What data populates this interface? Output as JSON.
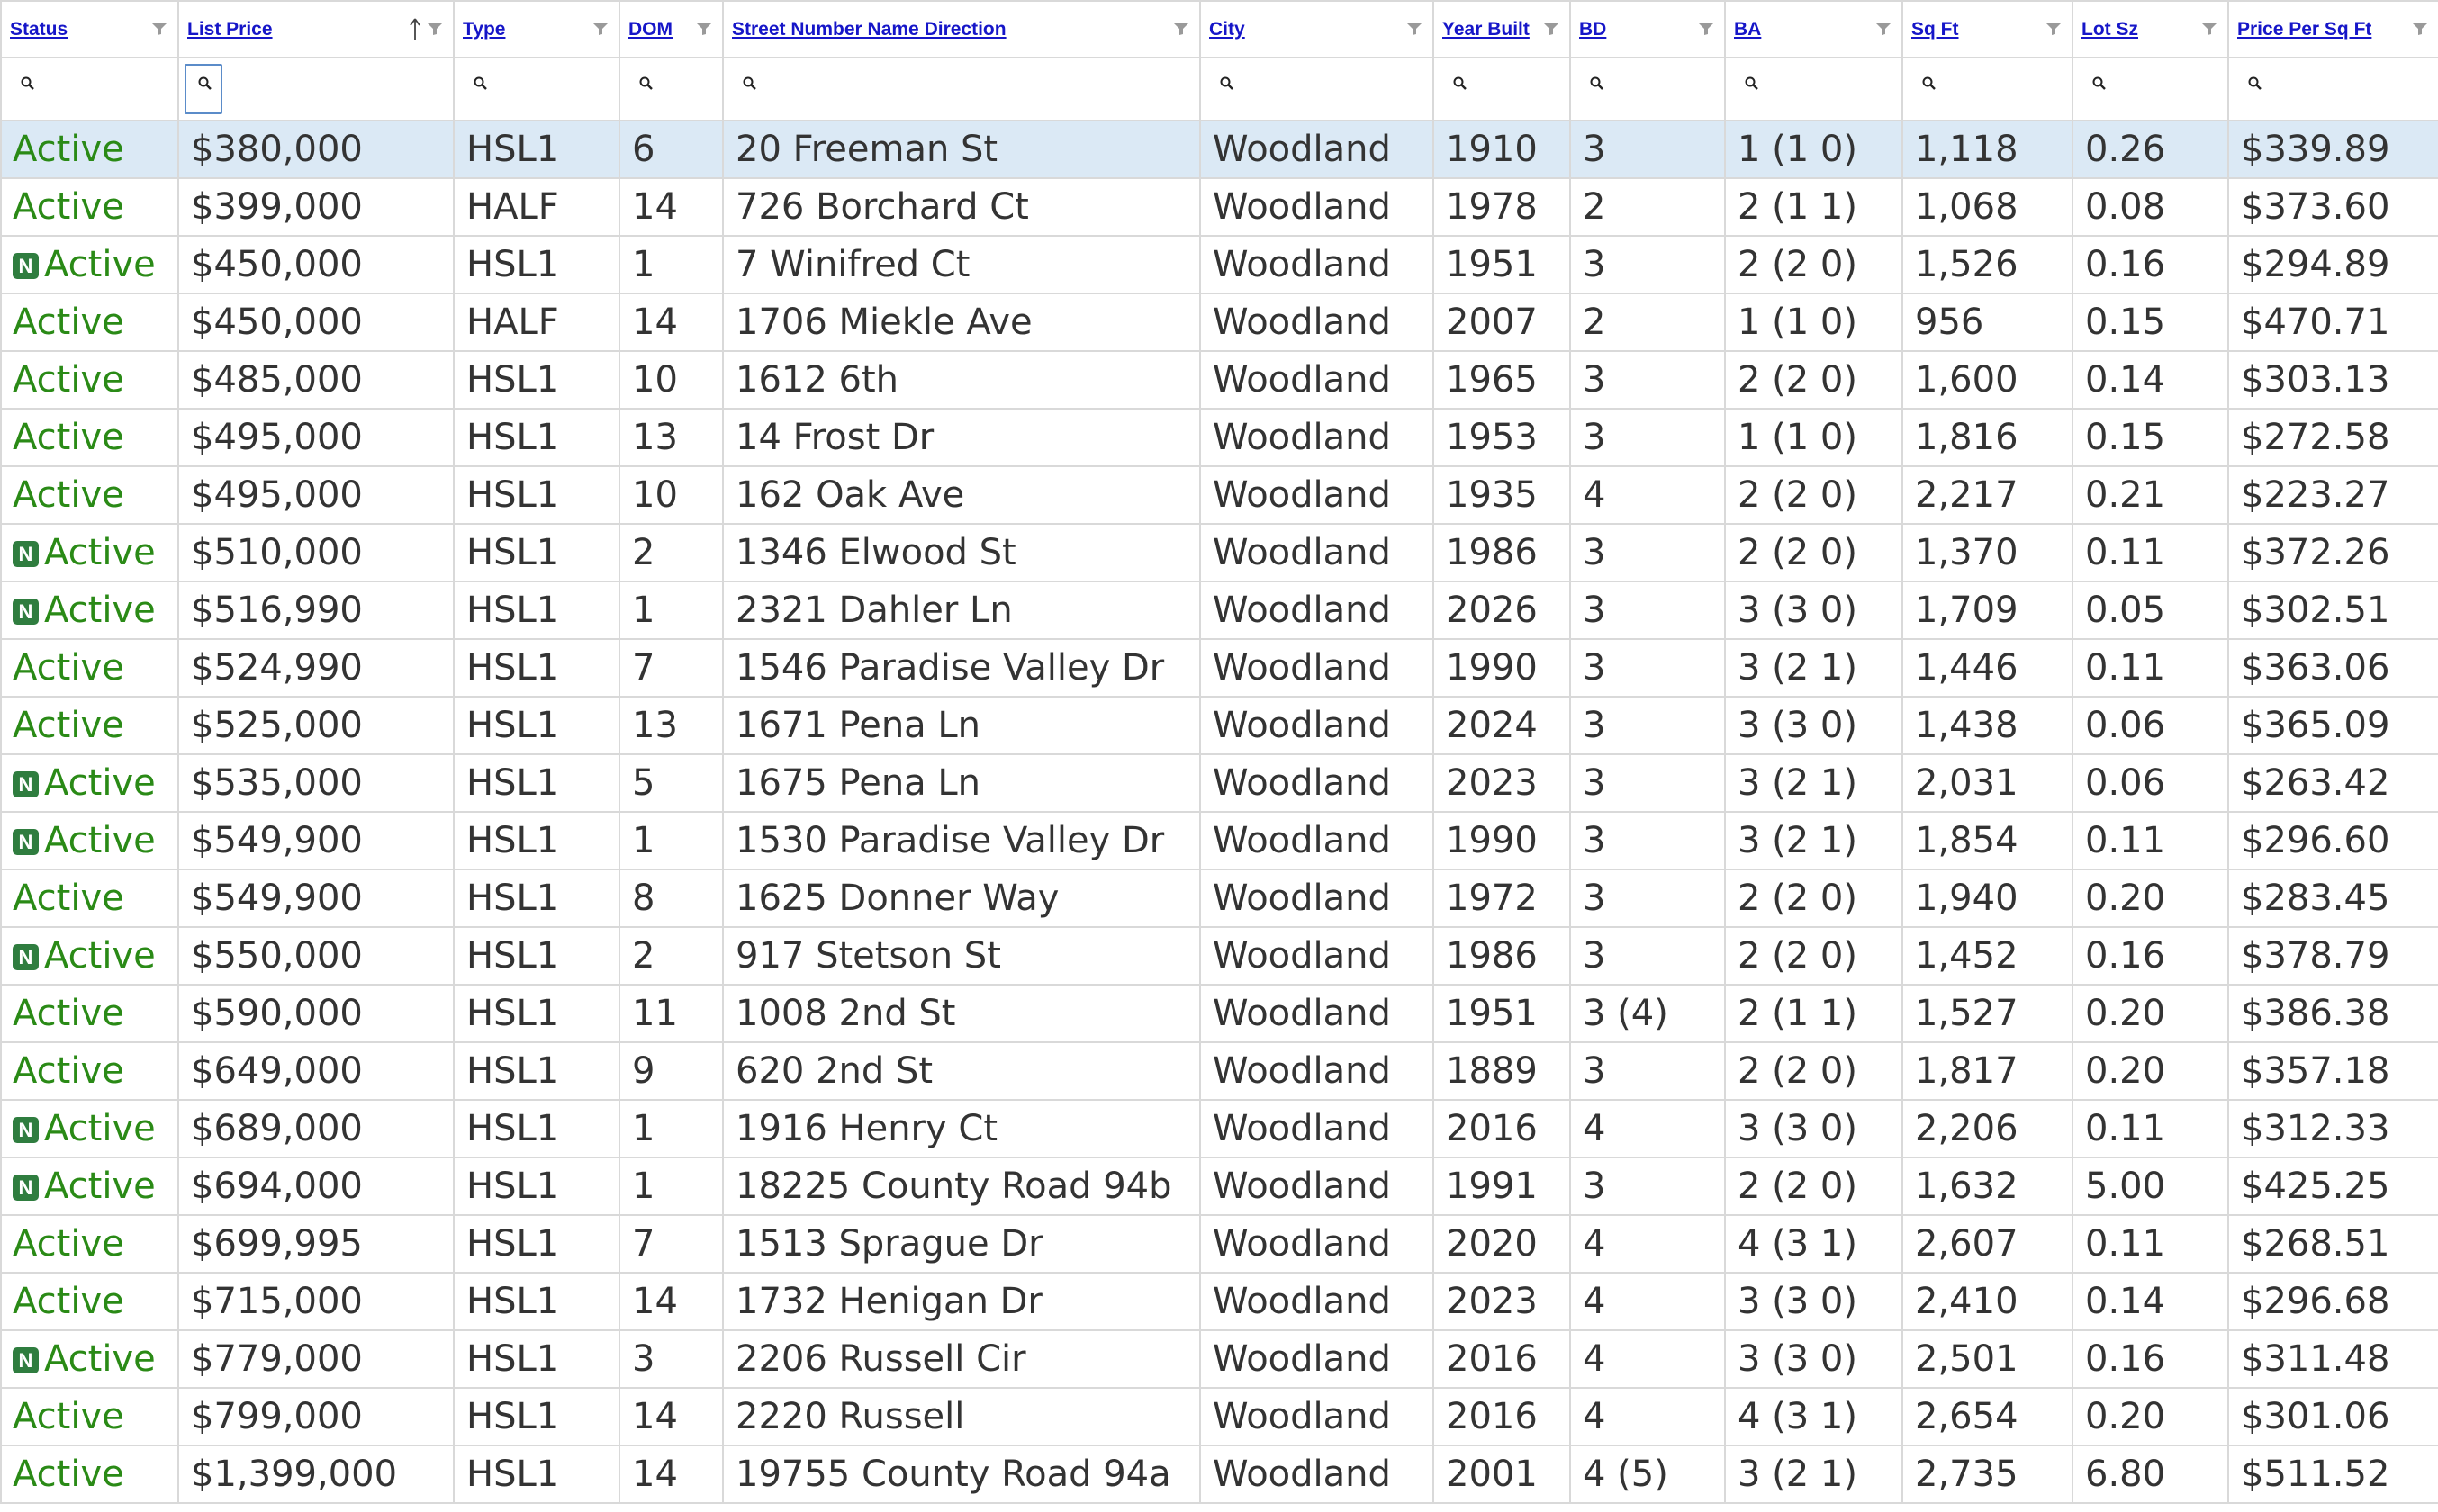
{
  "columns": [
    {
      "label": "Status"
    },
    {
      "label": "List Price"
    },
    {
      "label": "Type"
    },
    {
      "label": "DOM"
    },
    {
      "label": "Street Number Name Direction"
    },
    {
      "label": "City"
    },
    {
      "label": "Year Built"
    },
    {
      "label": "BD"
    },
    {
      "label": "BA"
    },
    {
      "label": "Sq Ft"
    },
    {
      "label": "Lot Sz"
    },
    {
      "label": "Price Per Sq Ft"
    }
  ],
  "sort": {
    "column": "List Price",
    "direction": "ascending"
  },
  "new_badge_label": "N",
  "colors": {
    "link": "#1616c8",
    "status_active": "#2a8a16",
    "badge": "#2f7d3f",
    "selected_row": "#dbe9f5"
  },
  "rows": [
    {
      "is_new": false,
      "status": "Active",
      "price": "$380,000",
      "type": "HSL1",
      "dom": "6",
      "address": "20 Freeman St",
      "city": "Woodland",
      "year": "1910",
      "bd": "3",
      "ba": "1 (1 0)",
      "sqft": "1,118",
      "lot": "0.26",
      "ppsf": "$339.89"
    },
    {
      "is_new": false,
      "status": "Active",
      "price": "$399,000",
      "type": "HALF",
      "dom": "14",
      "address": "726 Borchard Ct",
      "city": "Woodland",
      "year": "1978",
      "bd": "2",
      "ba": "2 (1 1)",
      "sqft": "1,068",
      "lot": "0.08",
      "ppsf": "$373.60"
    },
    {
      "is_new": true,
      "status": "Active",
      "price": "$450,000",
      "type": "HSL1",
      "dom": "1",
      "address": "7 Winifred Ct",
      "city": "Woodland",
      "year": "1951",
      "bd": "3",
      "ba": "2 (2 0)",
      "sqft": "1,526",
      "lot": "0.16",
      "ppsf": "$294.89"
    },
    {
      "is_new": false,
      "status": "Active",
      "price": "$450,000",
      "type": "HALF",
      "dom": "14",
      "address": "1706 Miekle Ave",
      "city": "Woodland",
      "year": "2007",
      "bd": "2",
      "ba": "1 (1 0)",
      "sqft": "956",
      "lot": "0.15",
      "ppsf": "$470.71"
    },
    {
      "is_new": false,
      "status": "Active",
      "price": "$485,000",
      "type": "HSL1",
      "dom": "10",
      "address": "1612 6th",
      "city": "Woodland",
      "year": "1965",
      "bd": "3",
      "ba": "2 (2 0)",
      "sqft": "1,600",
      "lot": "0.14",
      "ppsf": "$303.13"
    },
    {
      "is_new": false,
      "status": "Active",
      "price": "$495,000",
      "type": "HSL1",
      "dom": "13",
      "address": "14 Frost Dr",
      "city": "Woodland",
      "year": "1953",
      "bd": "3",
      "ba": "1 (1 0)",
      "sqft": "1,816",
      "lot": "0.15",
      "ppsf": "$272.58"
    },
    {
      "is_new": false,
      "status": "Active",
      "price": "$495,000",
      "type": "HSL1",
      "dom": "10",
      "address": "162 Oak Ave",
      "city": "Woodland",
      "year": "1935",
      "bd": "4",
      "ba": "2 (2 0)",
      "sqft": "2,217",
      "lot": "0.21",
      "ppsf": "$223.27"
    },
    {
      "is_new": true,
      "status": "Active",
      "price": "$510,000",
      "type": "HSL1",
      "dom": "2",
      "address": "1346 Elwood St",
      "city": "Woodland",
      "year": "1986",
      "bd": "3",
      "ba": "2 (2 0)",
      "sqft": "1,370",
      "lot": "0.11",
      "ppsf": "$372.26"
    },
    {
      "is_new": true,
      "status": "Active",
      "price": "$516,990",
      "type": "HSL1",
      "dom": "1",
      "address": "2321 Dahler Ln",
      "city": "Woodland",
      "year": "2026",
      "bd": "3",
      "ba": "3 (3 0)",
      "sqft": "1,709",
      "lot": "0.05",
      "ppsf": "$302.51"
    },
    {
      "is_new": false,
      "status": "Active",
      "price": "$524,990",
      "type": "HSL1",
      "dom": "7",
      "address": "1546 Paradise Valley Dr",
      "city": "Woodland",
      "year": "1990",
      "bd": "3",
      "ba": "3 (2 1)",
      "sqft": "1,446",
      "lot": "0.11",
      "ppsf": "$363.06"
    },
    {
      "is_new": false,
      "status": "Active",
      "price": "$525,000",
      "type": "HSL1",
      "dom": "13",
      "address": "1671 Pena Ln",
      "city": "Woodland",
      "year": "2024",
      "bd": "3",
      "ba": "3 (3 0)",
      "sqft": "1,438",
      "lot": "0.06",
      "ppsf": "$365.09"
    },
    {
      "is_new": true,
      "status": "Active",
      "price": "$535,000",
      "type": "HSL1",
      "dom": "5",
      "address": "1675 Pena Ln",
      "city": "Woodland",
      "year": "2023",
      "bd": "3",
      "ba": "3 (2 1)",
      "sqft": "2,031",
      "lot": "0.06",
      "ppsf": "$263.42"
    },
    {
      "is_new": true,
      "status": "Active",
      "price": "$549,900",
      "type": "HSL1",
      "dom": "1",
      "address": "1530 Paradise Valley Dr",
      "city": "Woodland",
      "year": "1990",
      "bd": "3",
      "ba": "3 (2 1)",
      "sqft": "1,854",
      "lot": "0.11",
      "ppsf": "$296.60"
    },
    {
      "is_new": false,
      "status": "Active",
      "price": "$549,900",
      "type": "HSL1",
      "dom": "8",
      "address": "1625 Donner Way",
      "city": "Woodland",
      "year": "1972",
      "bd": "3",
      "ba": "2 (2 0)",
      "sqft": "1,940",
      "lot": "0.20",
      "ppsf": "$283.45"
    },
    {
      "is_new": true,
      "status": "Active",
      "price": "$550,000",
      "type": "HSL1",
      "dom": "2",
      "address": "917 Stetson St",
      "city": "Woodland",
      "year": "1986",
      "bd": "3",
      "ba": "2 (2 0)",
      "sqft": "1,452",
      "lot": "0.16",
      "ppsf": "$378.79"
    },
    {
      "is_new": false,
      "status": "Active",
      "price": "$590,000",
      "type": "HSL1",
      "dom": "11",
      "address": "1008 2nd St",
      "city": "Woodland",
      "year": "1951",
      "bd": "3 (4)",
      "ba": "2 (1 1)",
      "sqft": "1,527",
      "lot": "0.20",
      "ppsf": "$386.38"
    },
    {
      "is_new": false,
      "status": "Active",
      "price": "$649,000",
      "type": "HSL1",
      "dom": "9",
      "address": "620 2nd St",
      "city": "Woodland",
      "year": "1889",
      "bd": "3",
      "ba": "2 (2 0)",
      "sqft": "1,817",
      "lot": "0.20",
      "ppsf": "$357.18"
    },
    {
      "is_new": true,
      "status": "Active",
      "price": "$689,000",
      "type": "HSL1",
      "dom": "1",
      "address": "1916 Henry Ct",
      "city": "Woodland",
      "year": "2016",
      "bd": "4",
      "ba": "3 (3 0)",
      "sqft": "2,206",
      "lot": "0.11",
      "ppsf": "$312.33"
    },
    {
      "is_new": true,
      "status": "Active",
      "price": "$694,000",
      "type": "HSL1",
      "dom": "1",
      "address": "18225 County Road 94b",
      "city": "Woodland",
      "year": "1991",
      "bd": "3",
      "ba": "2 (2 0)",
      "sqft": "1,632",
      "lot": "5.00",
      "ppsf": "$425.25"
    },
    {
      "is_new": false,
      "status": "Active",
      "price": "$699,995",
      "type": "HSL1",
      "dom": "7",
      "address": "1513 Sprague Dr",
      "city": "Woodland",
      "year": "2020",
      "bd": "4",
      "ba": "4 (3 1)",
      "sqft": "2,607",
      "lot": "0.11",
      "ppsf": "$268.51"
    },
    {
      "is_new": false,
      "status": "Active",
      "price": "$715,000",
      "type": "HSL1",
      "dom": "14",
      "address": "1732 Henigan Dr",
      "city": "Woodland",
      "year": "2023",
      "bd": "4",
      "ba": "3 (3 0)",
      "sqft": "2,410",
      "lot": "0.14",
      "ppsf": "$296.68"
    },
    {
      "is_new": true,
      "status": "Active",
      "price": "$779,000",
      "type": "HSL1",
      "dom": "3",
      "address": "2206 Russell Cir",
      "city": "Woodland",
      "year": "2016",
      "bd": "4",
      "ba": "3 (3 0)",
      "sqft": "2,501",
      "lot": "0.16",
      "ppsf": "$311.48"
    },
    {
      "is_new": false,
      "status": "Active",
      "price": "$799,000",
      "type": "HSL1",
      "dom": "14",
      "address": "2220 Russell",
      "city": "Woodland",
      "year": "2016",
      "bd": "4",
      "ba": "4 (3 1)",
      "sqft": "2,654",
      "lot": "0.20",
      "ppsf": "$301.06"
    },
    {
      "is_new": false,
      "status": "Active",
      "price": "$1,399,000",
      "type": "HSL1",
      "dom": "14",
      "address": "19755 County Road 94a",
      "city": "Woodland",
      "year": "2001",
      "bd": "4 (5)",
      "ba": "3 (2 1)",
      "sqft": "2,735",
      "lot": "6.80",
      "ppsf": "$511.52"
    }
  ]
}
